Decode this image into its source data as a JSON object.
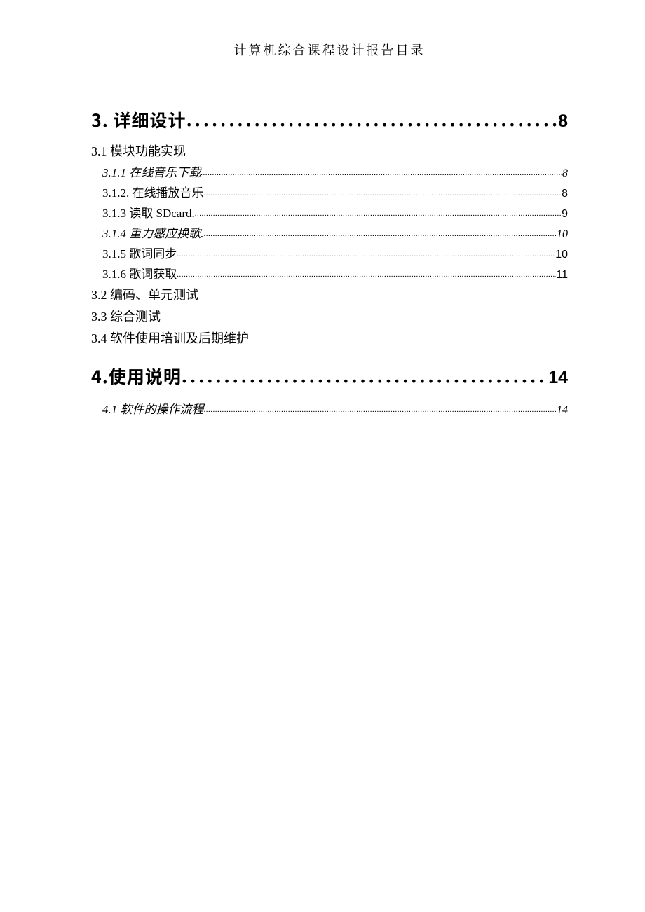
{
  "header": {
    "title": "计算机综合课程设计报告目录"
  },
  "leaders": {
    "h1": ".......................................................................",
    "h3": "........................................................................................................................................................................................................................"
  },
  "toc": {
    "sections": [
      {
        "level": "h1",
        "title": "3. 详细设计",
        "page": "8"
      },
      {
        "level": "h2",
        "title": "3.1 模块功能实现"
      },
      {
        "level": "h3",
        "italic": true,
        "title": "3.1.1 在线音乐下载",
        "page": "8"
      },
      {
        "level": "h3",
        "italic": false,
        "title": "3.1.2. 在线播放音乐",
        "page": "8"
      },
      {
        "level": "h3",
        "italic": false,
        "title": "3.1.3 读取 SDcard.",
        "page": "9"
      },
      {
        "level": "h3",
        "italic": true,
        "title": "3.1.4 重力感应换歌.",
        "page": "10"
      },
      {
        "level": "h3",
        "italic": false,
        "title": "3.1.5  歌词同步",
        "page": "10"
      },
      {
        "level": "h3",
        "italic": false,
        "title": "3.1.6  歌词获取",
        "page": "11"
      },
      {
        "level": "h2",
        "title": "3.2 编码、单元测试"
      },
      {
        "level": "h2",
        "title": "3.3 综合测试"
      },
      {
        "level": "h2",
        "title": "3.4 软件使用培训及后期维护"
      },
      {
        "level": "h1",
        "title": "4.使用说明 ",
        "page": "14"
      },
      {
        "level": "h3",
        "italic": true,
        "title": "4.1 软件的操作流程",
        "page": "14"
      }
    ]
  }
}
